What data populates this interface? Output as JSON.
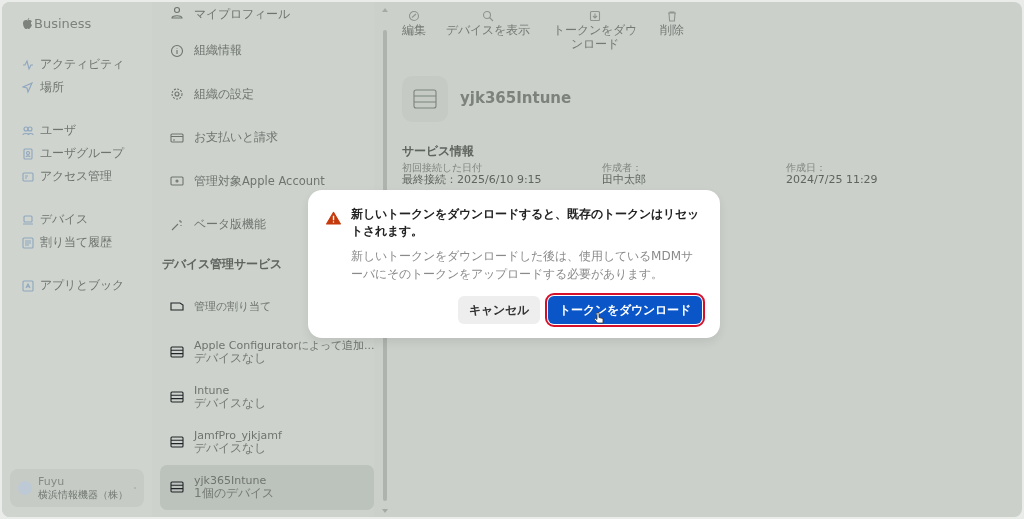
{
  "sidebar": {
    "brand": "Business",
    "groups": [
      [
        {
          "label": "アクティビティ"
        },
        {
          "label": "場所"
        }
      ],
      [
        {
          "label": "ユーザ"
        },
        {
          "label": "ユーザグループ"
        },
        {
          "label": "アクセス管理"
        }
      ],
      [
        {
          "label": "デバイス"
        },
        {
          "label": "割り当て履歴"
        }
      ],
      [
        {
          "label": "アプリとブック"
        }
      ]
    ],
    "account": {
      "name": "Fuyu",
      "org": "横浜情報機器（株）"
    }
  },
  "settings_list": {
    "items": [
      {
        "label": "マイプロフィール"
      },
      {
        "label": "組織情報"
      },
      {
        "label": "組織の設定"
      },
      {
        "label": "お支払いと請求"
      },
      {
        "label": "管理対象Apple Account"
      },
      {
        "label": "ベータ版機能"
      }
    ],
    "section": "デバイス管理サービス",
    "services": [
      {
        "kind": "assignment",
        "name": "管理の割り当て",
        "selected": false
      },
      {
        "kind": "server",
        "name": "Apple Configuratorによって追加...",
        "sub": "デバイスなし",
        "selected": false
      },
      {
        "kind": "server",
        "name": "Intune",
        "sub": "デバイスなし",
        "selected": false
      },
      {
        "kind": "server",
        "name": "JamfPro_yjkjamf",
        "sub": "デバイスなし",
        "selected": false
      },
      {
        "kind": "server",
        "name": "yjk365Intune",
        "sub": "1個のデバイス",
        "selected": true
      }
    ]
  },
  "toolbar": [
    {
      "label": "編集"
    },
    {
      "label": "デバイスを表示"
    },
    {
      "label": "トークンをダウンロード"
    },
    {
      "label": "削除"
    }
  ],
  "detail": {
    "title": "yjk365Intune",
    "section": "サービス情報",
    "fields": [
      {
        "label": "初回接続した日付",
        "value": "最終接続：2025/6/10 9:15"
      },
      {
        "label": "作成者：",
        "value": "田中太郎"
      },
      {
        "label": "作成日：",
        "value": "2024/7/25 11:29"
      }
    ]
  },
  "dialog": {
    "title": "新しいトークンをダウンロードすると、既存のトークンはリセットされます。",
    "message": "新しいトークンをダウンロードした後は、使用しているMDMサーバにそのトークンをアップロードする必要があります。",
    "buttons": [
      {
        "label": "キャンセル",
        "kind": "secondary",
        "highlighted": false
      },
      {
        "label": "トークンをダウンロード",
        "kind": "primary",
        "highlighted": true
      }
    ]
  }
}
